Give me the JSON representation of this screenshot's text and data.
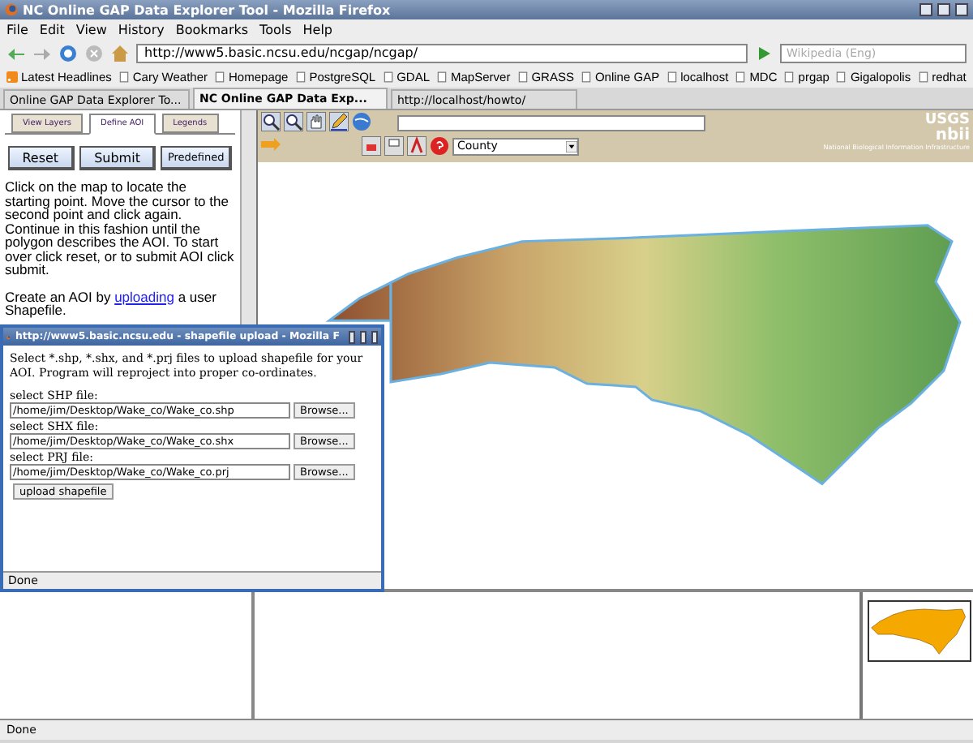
{
  "window": {
    "title": "NC Online GAP Data Explorer Tool - Mozilla Firefox"
  },
  "menu": [
    "File",
    "Edit",
    "View",
    "History",
    "Bookmarks",
    "Tools",
    "Help"
  ],
  "navigation": {
    "url": "http://www5.basic.ncsu.edu/ncgap/ncgap/",
    "search_placeholder": "Wikipedia (Eng)"
  },
  "bookmarks": [
    "Latest Headlines",
    "Cary Weather",
    "Homepage",
    "PostgreSQL",
    "GDAL",
    "MapServer",
    "GRASS",
    "Online GAP",
    "localhost",
    "MDC",
    "prgap",
    "Gigalopolis",
    "redhat"
  ],
  "tabs": [
    {
      "label": "Online GAP Data Explorer To...",
      "selected": false
    },
    {
      "label": "NC Online GAP Data Exp...",
      "selected": true
    },
    {
      "label": "http://localhost/howto/",
      "selected": false
    }
  ],
  "side_panel": {
    "tabs": [
      {
        "label": "View Layers",
        "selected": false
      },
      {
        "label": "Define AOI",
        "selected": true
      },
      {
        "label": "Legends",
        "selected": false
      }
    ],
    "buttons": [
      "Reset",
      "Submit",
      "Predefined"
    ],
    "instructions": "Click on the map to locate the starting point. Move the cursor to the second point and click again. Continue in this fashion until the polygon describes the AOI. To start over click reset, or to submit AOI click submit.",
    "upload_before": "Create an AOI by",
    "upload_link": "uploading",
    "upload_after": "a user Shapefile."
  },
  "map_toolbar": {
    "layer_select": "County",
    "logo": "USGS",
    "logo_2": "nbii",
    "caption": "National Biological Information Infrastructure"
  },
  "popup": {
    "title": "http://www5.basic.ncsu.edu - shapefile upload - Mozilla F",
    "description": "Select *.shp, *.shx, and *.prj files to upload shapefile for your AOI. Program will reproject into proper co-ordinates.",
    "fields": [
      {
        "label": "select SHP file:",
        "value": "/home/jim/Desktop/Wake_co/Wake_co.shp",
        "button": "Browse..."
      },
      {
        "label": "select SHX file:",
        "value": "/home/jim/Desktop/Wake_co/Wake_co.shx",
        "button": "Browse..."
      },
      {
        "label": "select PRJ file:",
        "value": "/home/jim/Desktop/Wake_co/Wake_co.prj",
        "button": "Browse..."
      }
    ],
    "submit": "upload shapefile",
    "status": "Done"
  },
  "status_bar": "Done"
}
